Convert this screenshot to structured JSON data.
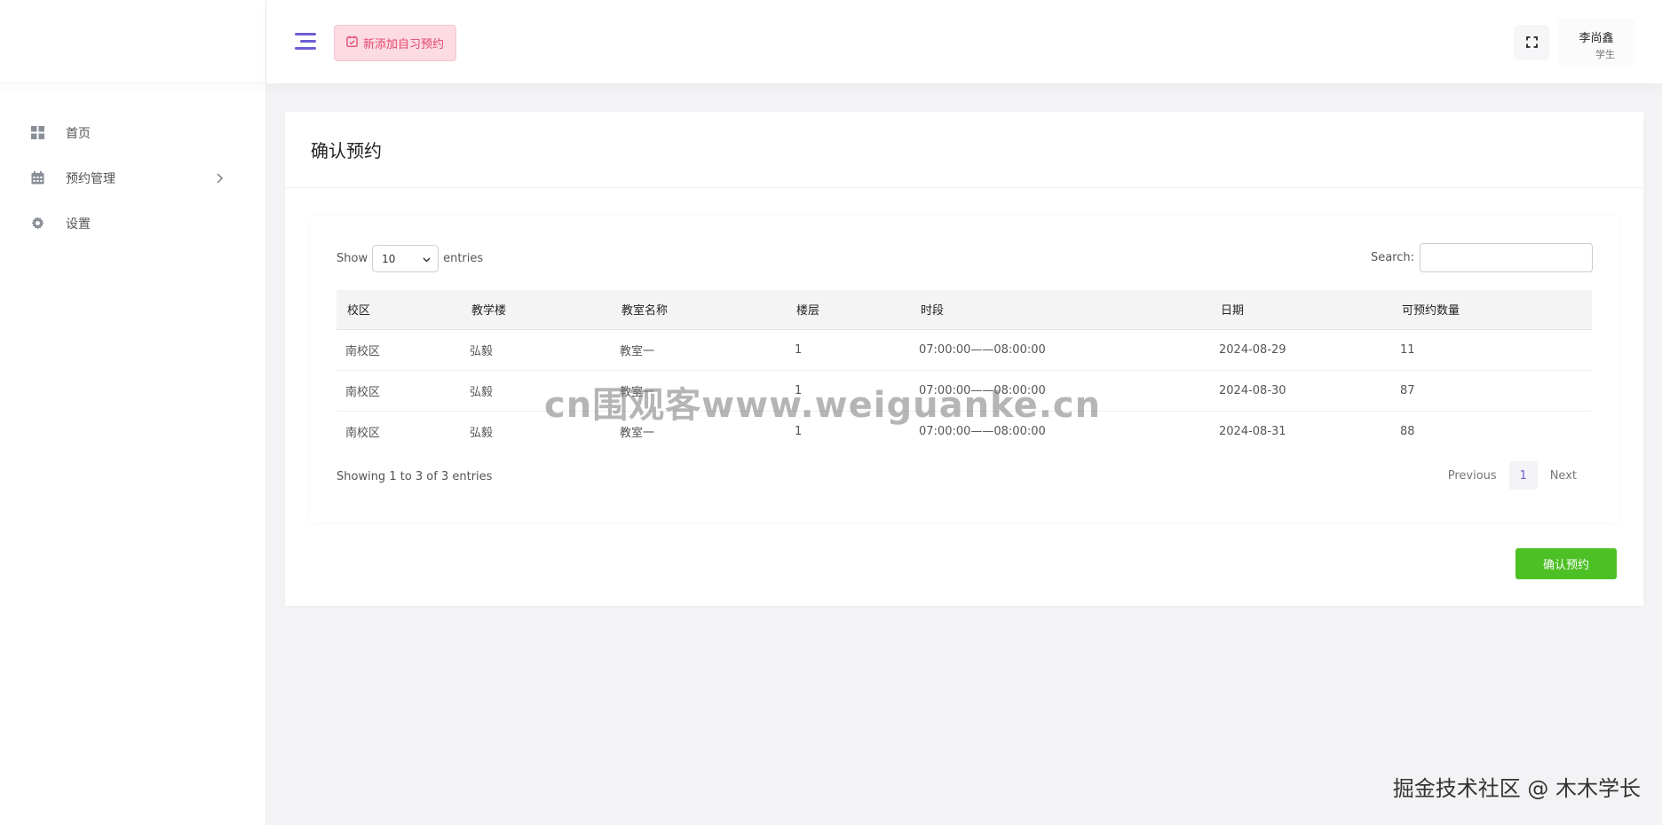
{
  "sidebar": {
    "items": [
      {
        "label": "首页",
        "icon": "dashboard-grid-icon"
      },
      {
        "label": "预约管理",
        "icon": "calendar-icon",
        "has_submenu": true
      },
      {
        "label": "设置",
        "icon": "gear-icon"
      }
    ]
  },
  "header": {
    "add_button_label": "新添加自习预约",
    "user_name": "李尚鑫",
    "user_role": "学生"
  },
  "page": {
    "title": "确认预约"
  },
  "table_controls": {
    "show_label": "Show",
    "entries_value": "10",
    "entries_label": "entries",
    "search_label": "Search:",
    "search_value": ""
  },
  "table": {
    "columns": [
      "校区",
      "教学楼",
      "教室名称",
      "楼层",
      "时段",
      "日期",
      "可预约数量"
    ],
    "rows": [
      [
        "南校区",
        "弘毅",
        "教室一",
        "1",
        "07:00:00——08:00:00",
        "2024-08-29",
        "11"
      ],
      [
        "南校区",
        "弘毅",
        "教室一",
        "1",
        "07:00:00——08:00:00",
        "2024-08-30",
        "87"
      ],
      [
        "南校区",
        "弘毅",
        "教室一",
        "1",
        "07:00:00——08:00:00",
        "2024-08-31",
        "88"
      ]
    ]
  },
  "pagination": {
    "info": "Showing 1 to 3 of 3 entries",
    "previous_label": "Previous",
    "current_page": "1",
    "next_label": "Next"
  },
  "actions": {
    "confirm_label": "确认预约"
  },
  "overlays": {
    "watermark": "cn围观客www.weiguanke.cn",
    "footer": "掘金技术社区 @ 木木学长"
  },
  "colors": {
    "accent": "#6c5ed3",
    "add_button_bg": "#fcdbe3",
    "add_button_text": "#e2476f",
    "confirm_bg": "#4cc024"
  }
}
